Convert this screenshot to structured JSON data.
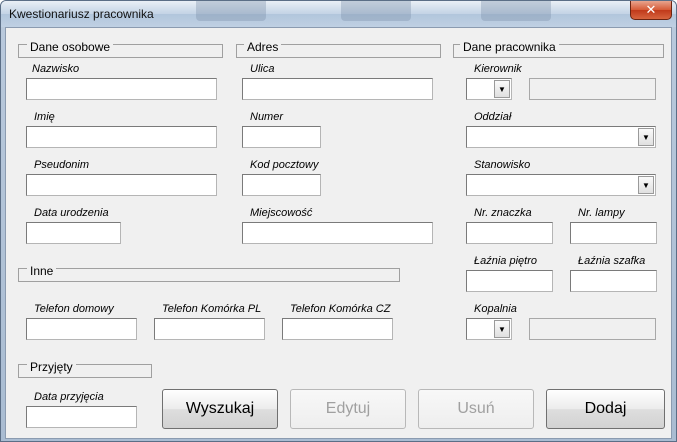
{
  "window": {
    "title": "Kwestionariusz pracownika",
    "close_glyph": "✕"
  },
  "sections": {
    "personal": "Dane osobowe",
    "address": "Adres",
    "employee": "Dane pracownika",
    "other": "Inne",
    "hired": "Przyjęty"
  },
  "labels": {
    "surname": "Nazwisko",
    "first_name": "Imię",
    "nickname": "Pseudonim",
    "birth_date": "Data urodzenia",
    "street": "Ulica",
    "number": "Numer",
    "postal_code": "Kod pocztowy",
    "city": "Miejscowość",
    "manager": "Kierownik",
    "department": "Oddział",
    "position": "Stanowisko",
    "badge_no": "Nr. znaczka",
    "lamp_no": "Nr. lampy",
    "bath_floor": "Łaźnia piętro",
    "bath_locker": "Łaźnia szafka",
    "phone_home": "Telefon domowy",
    "phone_mobile_pl": "Telefon Komórka PL",
    "phone_mobile_cz": "Telefon Komórka CZ",
    "mine": "Kopalnia",
    "hire_date": "Data przyjęcia"
  },
  "values": {
    "surname": "",
    "first_name": "",
    "nickname": "",
    "birth_date": "",
    "street": "",
    "number": "",
    "postal_code": "",
    "city": "",
    "manager": "",
    "manager_name": "",
    "department": "",
    "position": "",
    "badge_no": "",
    "lamp_no": "",
    "bath_floor": "",
    "bath_locker": "",
    "phone_home": "",
    "phone_mobile_pl": "",
    "phone_mobile_cz": "",
    "mine": "",
    "mine_name": "",
    "hire_date": ""
  },
  "icons": {
    "dropdown": "▼"
  },
  "buttons": {
    "search": "Wyszukaj",
    "edit": "Edytuj",
    "delete": "Usuń",
    "add": "Dodaj"
  }
}
